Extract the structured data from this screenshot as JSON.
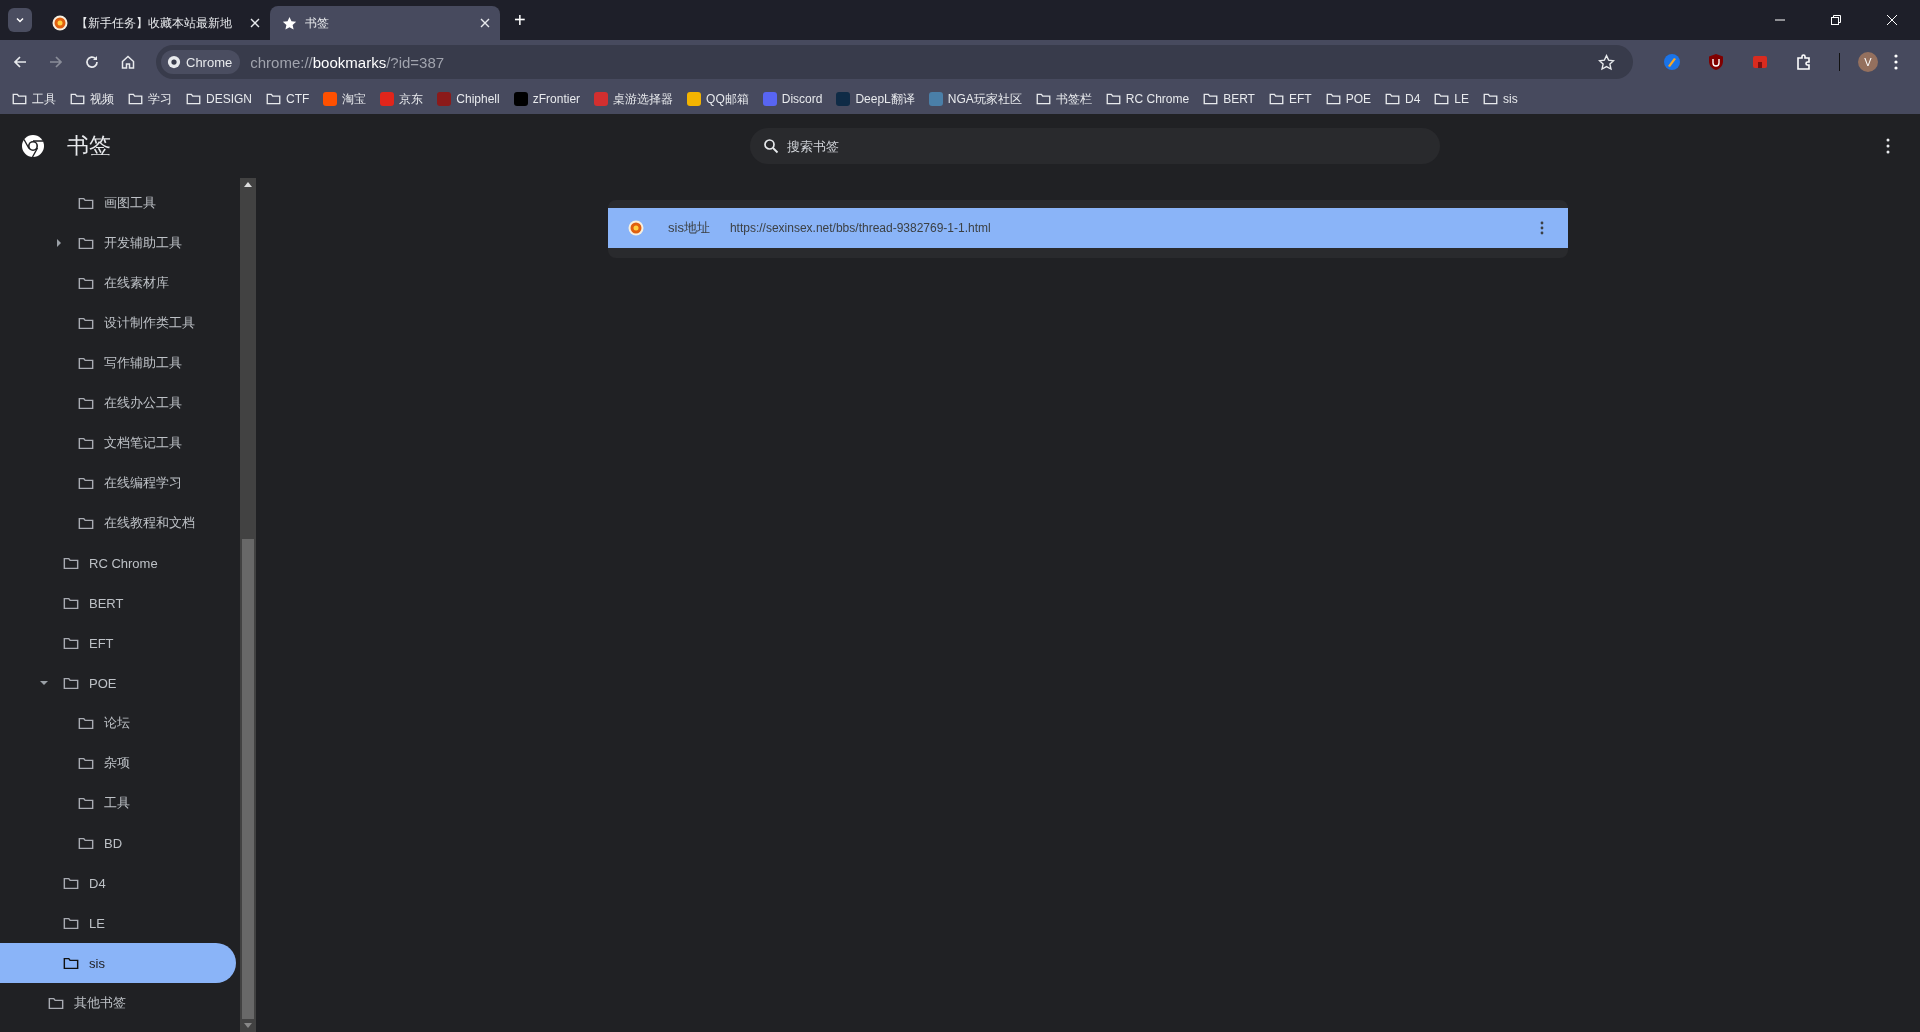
{
  "tabs": [
    {
      "title": "【新手任务】收藏本站最新地",
      "kind": "site",
      "selected": false
    },
    {
      "title": "书签",
      "kind": "bookmarks",
      "selected": true
    }
  ],
  "new_tab": "+",
  "address": {
    "chip": "Chrome",
    "scheme": "chrome://",
    "host": "bookmarks",
    "path": "/?id=387"
  },
  "profile": {
    "initial": "V"
  },
  "bookmarks_bar": [
    {
      "kind": "folder",
      "label": "工具"
    },
    {
      "kind": "folder",
      "label": "视频"
    },
    {
      "kind": "folder",
      "label": "学习"
    },
    {
      "kind": "folder",
      "label": "DESIGN"
    },
    {
      "kind": "folder",
      "label": "CTF"
    },
    {
      "kind": "site",
      "label": "淘宝",
      "color": "#ff5000"
    },
    {
      "kind": "site",
      "label": "京东",
      "color": "#e1251b"
    },
    {
      "kind": "site",
      "label": "Chiphell",
      "color": "#8b1a1a"
    },
    {
      "kind": "site",
      "label": "zFrontier",
      "color": "#000000"
    },
    {
      "kind": "site",
      "label": "桌游选择器",
      "color": "#d32f2f"
    },
    {
      "kind": "site",
      "label": "QQ邮箱",
      "color": "#f4b400"
    },
    {
      "kind": "site",
      "label": "Discord",
      "color": "#5865f2"
    },
    {
      "kind": "site",
      "label": "DeepL翻译",
      "color": "#0f2b46"
    },
    {
      "kind": "site",
      "label": "NGA玩家社区",
      "color": "#4a7fa8"
    },
    {
      "kind": "folder",
      "label": "书签栏"
    },
    {
      "kind": "folder",
      "label": "RC Chrome"
    },
    {
      "kind": "folder",
      "label": "BERT"
    },
    {
      "kind": "folder",
      "label": "EFT"
    },
    {
      "kind": "folder",
      "label": "POE"
    },
    {
      "kind": "folder",
      "label": "D4"
    },
    {
      "kind": "folder",
      "label": "LE"
    },
    {
      "kind": "folder",
      "label": "sis"
    }
  ],
  "page": {
    "title": "书签",
    "search": {
      "placeholder": "搜索书签"
    }
  },
  "tree": [
    {
      "children": [
        {
          "children": [
            {
              "label": "画图工具",
              "selected": false
            },
            {
              "label": "开发辅助工具",
              "selected": false,
              "expanded": false
            },
            {
              "label": "在线素材库",
              "selected": false
            },
            {
              "label": "设计制作类工具",
              "selected": false
            },
            {
              "label": "写作辅助工具",
              "selected": false
            },
            {
              "label": "在线办公工具",
              "selected": false
            },
            {
              "label": "文档笔记工具",
              "selected": false
            },
            {
              "label": "在线编程学习",
              "selected": false
            },
            {
              "label": "在线教程和文档",
              "selected": false
            }
          ]
        },
        {
          "label": "RC Chrome",
          "selected": false
        },
        {
          "label": "BERT",
          "selected": false
        },
        {
          "label": "EFT",
          "selected": false
        },
        {
          "label": "POE",
          "selected": false,
          "expanded": true,
          "children": [
            {
              "label": "论坛",
              "selected": false
            },
            {
              "label": "杂项",
              "selected": false
            },
            {
              "label": "工具",
              "selected": false
            },
            {
              "label": "BD",
              "selected": false
            }
          ]
        },
        {
          "label": "D4",
          "selected": false
        },
        {
          "label": "LE",
          "selected": false
        },
        {
          "label": "sis",
          "selected": true
        }
      ]
    },
    {
      "label": "其他书签",
      "selected": false
    }
  ],
  "bookmarks": [
    {
      "title": "sis地址",
      "url": "https://sexinsex.net/bbs/thread-9382769-1-1.html",
      "selected": true
    }
  ]
}
